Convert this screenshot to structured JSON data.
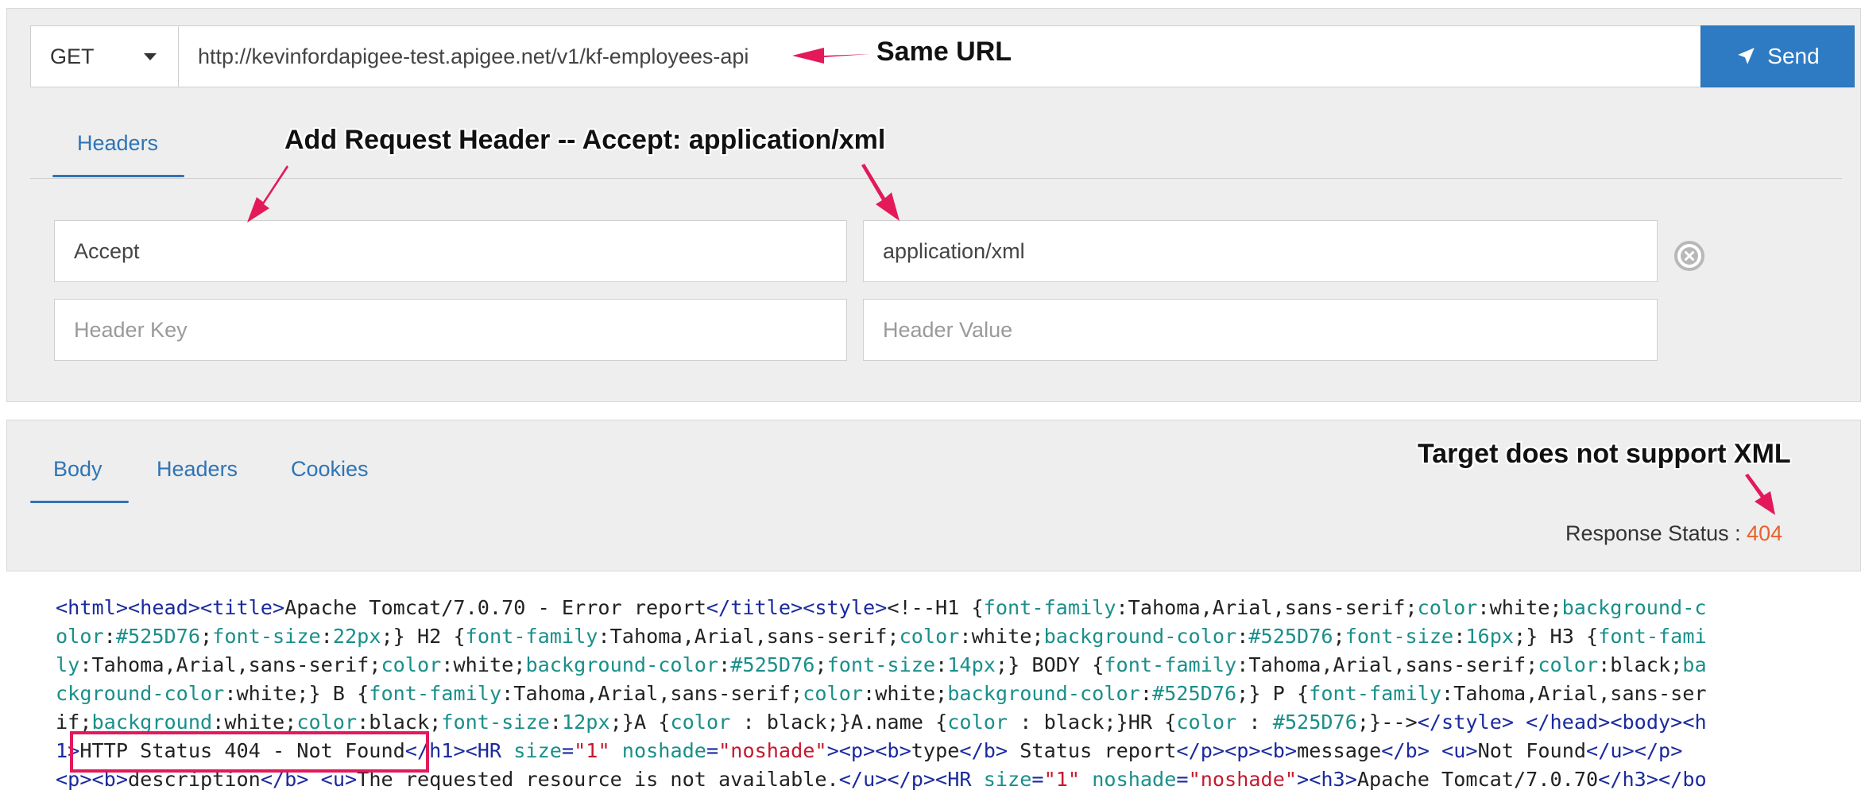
{
  "request": {
    "method": "GET",
    "url": "http://kevinfordapigee-test.apigee.net/v1/kf-employees-api",
    "send_label": "Send"
  },
  "request_tabs": {
    "headers": "Headers"
  },
  "headers": {
    "row1": {
      "key": "Accept",
      "value": "application/xml"
    },
    "row2": {
      "key_placeholder": "Header Key",
      "value_placeholder": "Header Value"
    }
  },
  "response_tabs": {
    "body": "Body",
    "headers": "Headers",
    "cookies": "Cookies"
  },
  "response": {
    "status_label": "Response Status : ",
    "status_code": "404"
  },
  "annotations": {
    "same_url": "Same URL",
    "add_header": "Add Request Header -- Accept: application/xml",
    "target": "Target does not support XML"
  },
  "colors": {
    "accent": "#2e7bc4",
    "status_error": "#e8612c",
    "annotation_pink": "#e3195a"
  },
  "body_lines": [
    [
      {
        "c": "t",
        "v": "<html><head><title>"
      },
      {
        "c": "",
        "v": "Apache Tomcat/7.0.70 - Error report"
      },
      {
        "c": "t",
        "v": "</title><style>"
      },
      {
        "c": "",
        "v": "<!--H1 {"
      },
      {
        "c": "p",
        "v": "font-family"
      },
      {
        "c": "",
        "v": ":Tahoma,Arial,sans-serif;"
      },
      {
        "c": "p",
        "v": "color"
      },
      {
        "c": "",
        "v": ":white;"
      },
      {
        "c": "p",
        "v": "background-c"
      }
    ],
    [
      {
        "c": "p",
        "v": "olor"
      },
      {
        "c": "",
        "v": ":"
      },
      {
        "c": "p",
        "v": "#525D76"
      },
      {
        "c": "",
        "v": ";"
      },
      {
        "c": "p",
        "v": "font-size"
      },
      {
        "c": "",
        "v": ":"
      },
      {
        "c": "p",
        "v": "22px"
      },
      {
        "c": "",
        "v": ";} H2 {"
      },
      {
        "c": "p",
        "v": "font-family"
      },
      {
        "c": "",
        "v": ":Tahoma,Arial,sans-serif;"
      },
      {
        "c": "p",
        "v": "color"
      },
      {
        "c": "",
        "v": ":white;"
      },
      {
        "c": "p",
        "v": "background-color"
      },
      {
        "c": "",
        "v": ":"
      },
      {
        "c": "p",
        "v": "#525D76"
      },
      {
        "c": "",
        "v": ";"
      },
      {
        "c": "p",
        "v": "font-size"
      },
      {
        "c": "",
        "v": ":"
      },
      {
        "c": "p",
        "v": "16px"
      },
      {
        "c": "",
        "v": ";} H3 {"
      },
      {
        "c": "p",
        "v": "font-fami"
      }
    ],
    [
      {
        "c": "p",
        "v": "ly"
      },
      {
        "c": "",
        "v": ":Tahoma,Arial,sans-serif;"
      },
      {
        "c": "p",
        "v": "color"
      },
      {
        "c": "",
        "v": ":white;"
      },
      {
        "c": "p",
        "v": "background-color"
      },
      {
        "c": "",
        "v": ":"
      },
      {
        "c": "p",
        "v": "#525D76"
      },
      {
        "c": "",
        "v": ";"
      },
      {
        "c": "p",
        "v": "font-size"
      },
      {
        "c": "",
        "v": ":"
      },
      {
        "c": "p",
        "v": "14px"
      },
      {
        "c": "",
        "v": ";} BODY {"
      },
      {
        "c": "p",
        "v": "font-family"
      },
      {
        "c": "",
        "v": ":Tahoma,Arial,sans-serif;"
      },
      {
        "c": "p",
        "v": "color"
      },
      {
        "c": "",
        "v": ":black;"
      },
      {
        "c": "p",
        "v": "ba"
      }
    ],
    [
      {
        "c": "p",
        "v": "ckground-color"
      },
      {
        "c": "",
        "v": ":white;} B {"
      },
      {
        "c": "p",
        "v": "font-family"
      },
      {
        "c": "",
        "v": ":Tahoma,Arial,sans-serif;"
      },
      {
        "c": "p",
        "v": "color"
      },
      {
        "c": "",
        "v": ":white;"
      },
      {
        "c": "p",
        "v": "background-color"
      },
      {
        "c": "",
        "v": ":"
      },
      {
        "c": "p",
        "v": "#525D76"
      },
      {
        "c": "",
        "v": ";} P {"
      },
      {
        "c": "p",
        "v": "font-family"
      },
      {
        "c": "",
        "v": ":Tahoma,Arial,sans-ser"
      }
    ],
    [
      {
        "c": "",
        "v": "if;"
      },
      {
        "c": "p",
        "v": "background"
      },
      {
        "c": "",
        "v": ":white;"
      },
      {
        "c": "p",
        "v": "color"
      },
      {
        "c": "",
        "v": ":black;"
      },
      {
        "c": "p",
        "v": "font-size"
      },
      {
        "c": "",
        "v": ":"
      },
      {
        "c": "p",
        "v": "12px"
      },
      {
        "c": "",
        "v": ";}A {"
      },
      {
        "c": "p",
        "v": "color"
      },
      {
        "c": "",
        "v": " : black;}A.name {"
      },
      {
        "c": "p",
        "v": "color"
      },
      {
        "c": "",
        "v": " : black;}HR {"
      },
      {
        "c": "p",
        "v": "color"
      },
      {
        "c": "",
        "v": " : "
      },
      {
        "c": "p",
        "v": "#525D76"
      },
      {
        "c": "",
        "v": ";}-->"
      },
      {
        "c": "t",
        "v": "</style> </head><body><h"
      }
    ],
    [
      {
        "c": "t",
        "v": "1>"
      },
      {
        "c": "",
        "v": "HTTP Status 404 - Not Found"
      },
      {
        "c": "t",
        "v": "</h1><HR "
      },
      {
        "c": "p",
        "v": "size"
      },
      {
        "c": "t",
        "v": "="
      },
      {
        "c": "s",
        "v": "\"1\""
      },
      {
        "c": "t",
        "v": " "
      },
      {
        "c": "p",
        "v": "noshade"
      },
      {
        "c": "t",
        "v": "="
      },
      {
        "c": "s",
        "v": "\"noshade\""
      },
      {
        "c": "t",
        "v": "><p><b>"
      },
      {
        "c": "",
        "v": "type"
      },
      {
        "c": "t",
        "v": "</b>"
      },
      {
        "c": "",
        "v": " Status report"
      },
      {
        "c": "t",
        "v": "</p><p><b>"
      },
      {
        "c": "",
        "v": "message"
      },
      {
        "c": "t",
        "v": "</b>"
      },
      {
        "c": "",
        "v": " "
      },
      {
        "c": "t",
        "v": "<u>"
      },
      {
        "c": "",
        "v": "Not Found"
      },
      {
        "c": "t",
        "v": "</u></p>"
      }
    ],
    [
      {
        "c": "t",
        "v": "<p><b>"
      },
      {
        "c": "",
        "v": "description"
      },
      {
        "c": "t",
        "v": "</b>"
      },
      {
        "c": "",
        "v": " "
      },
      {
        "c": "t",
        "v": "<u>"
      },
      {
        "c": "",
        "v": "The requested resource is not available."
      },
      {
        "c": "t",
        "v": "</u></p><HR "
      },
      {
        "c": "p",
        "v": "size"
      },
      {
        "c": "t",
        "v": "="
      },
      {
        "c": "s",
        "v": "\"1\""
      },
      {
        "c": "t",
        "v": " "
      },
      {
        "c": "p",
        "v": "noshade"
      },
      {
        "c": "t",
        "v": "="
      },
      {
        "c": "s",
        "v": "\"noshade\""
      },
      {
        "c": "t",
        "v": "><h3>"
      },
      {
        "c": "",
        "v": "Apache Tomcat/7.0.70"
      },
      {
        "c": "t",
        "v": "</h3></bo"
      }
    ]
  ]
}
